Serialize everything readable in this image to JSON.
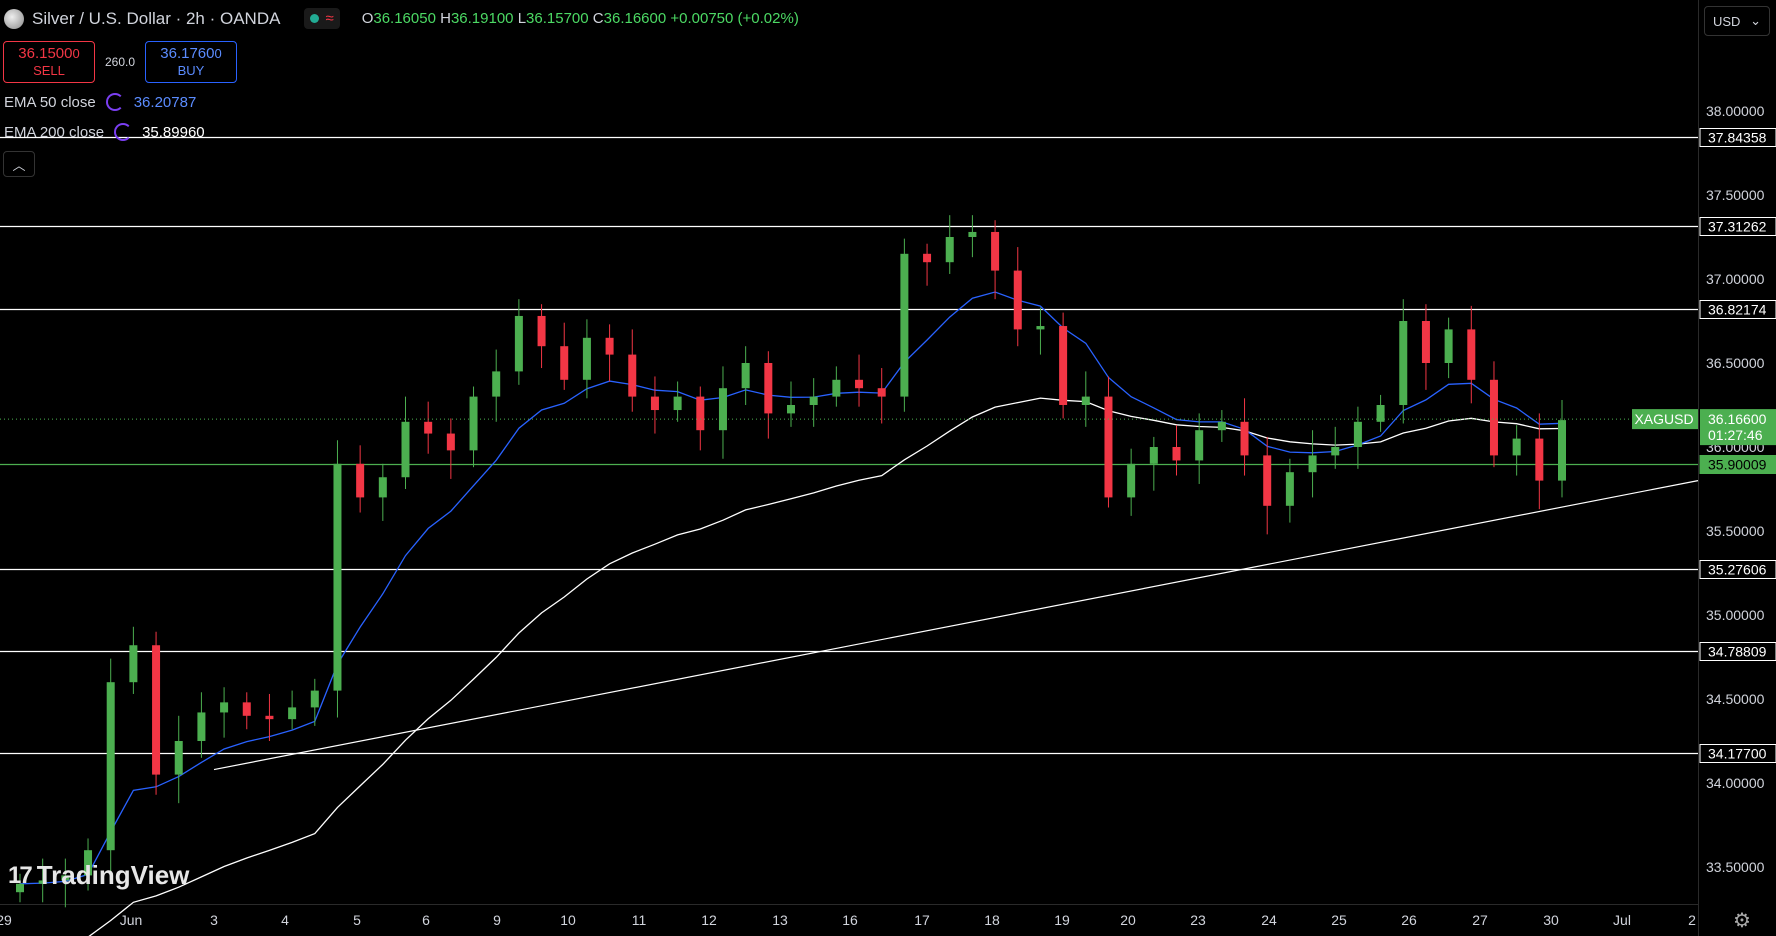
{
  "header": {
    "symbol_title": "Silver / U.S. Dollar · 2h · OANDA",
    "ohlc": {
      "o_label": "O",
      "o": "36.16050",
      "h_label": "H",
      "h": "36.19100",
      "l_label": "L",
      "l": "36.15700",
      "c_label": "C",
      "c": "36.16600",
      "change": "+0.00750 (+0.02%)"
    }
  },
  "trade": {
    "sell_price": "36.1500",
    "sell_price_sup": "0",
    "sell_label": "SELL",
    "spread": "260.0",
    "buy_price": "36.1760",
    "buy_price_sup": "0",
    "buy_label": "BUY"
  },
  "indicators": {
    "ema50_label": "EMA 50 close",
    "ema50_value": "36.20787",
    "ema50_color": "#2962ff",
    "ema200_label": "EMA 200 close",
    "ema200_value": "35.89960",
    "ema200_color": "#ffffff"
  },
  "currency_select": "USD",
  "watermark": "TradingView",
  "chart_data": {
    "type": "candlestick",
    "symbol_tag": "XAGUSD",
    "current_price": "36.16600",
    "countdown": "01:27:46",
    "y_axis_ticks": [
      "38.00000",
      "37.50000",
      "37.00000",
      "36.50000",
      "36.00000",
      "35.50000",
      "35.00000",
      "34.50000",
      "34.00000",
      "33.50000"
    ],
    "ylim": [
      33.3,
      38.2
    ],
    "x_axis_ticks": [
      "29",
      "Jun",
      "3",
      "4",
      "5",
      "6",
      "9",
      "10",
      "11",
      "12",
      "13",
      "16",
      "17",
      "18",
      "19",
      "20",
      "23",
      "24",
      "25",
      "26",
      "27",
      "30",
      "Jul",
      "2"
    ],
    "horizontal_levels": [
      "37.84358",
      "37.31262",
      "36.82174",
      "35.90009",
      "35.27606",
      "34.78809",
      "34.17700"
    ],
    "highlight_level": "35.90009",
    "colors": {
      "up": "#4caf50",
      "down": "#f23645",
      "ema50": "#2962ff",
      "ema200": "#ffffff",
      "level": "#ffffff",
      "price_tag": "#4caf50"
    },
    "trendline": {
      "from": {
        "date": "Jun 2",
        "price": 34.08
      },
      "to": {
        "date": "Jul 1",
        "price": 35.7
      }
    },
    "candles_approx_closes": [
      33.4,
      33.42,
      33.45,
      33.6,
      34.6,
      34.82,
      34.05,
      34.25,
      34.42,
      34.48,
      34.4,
      34.38,
      34.45,
      34.55,
      35.9,
      35.7,
      35.82,
      36.15,
      36.08,
      35.98,
      36.3,
      36.45,
      36.78,
      36.6,
      36.4,
      36.65,
      36.55,
      36.3,
      36.22,
      36.3,
      36.1,
      36.35,
      36.5,
      36.2,
      36.25,
      36.3,
      36.4,
      36.35,
      36.3,
      37.15,
      37.1,
      37.25,
      37.28,
      37.05,
      36.7,
      36.72,
      36.25,
      36.3,
      35.7,
      35.9,
      36.0,
      35.92,
      36.1,
      36.15,
      35.95,
      35.65,
      35.85,
      35.95,
      36.0,
      36.15,
      36.25,
      36.75,
      36.5,
      36.7,
      36.4,
      35.95,
      36.05,
      35.8,
      36.16
    ]
  }
}
